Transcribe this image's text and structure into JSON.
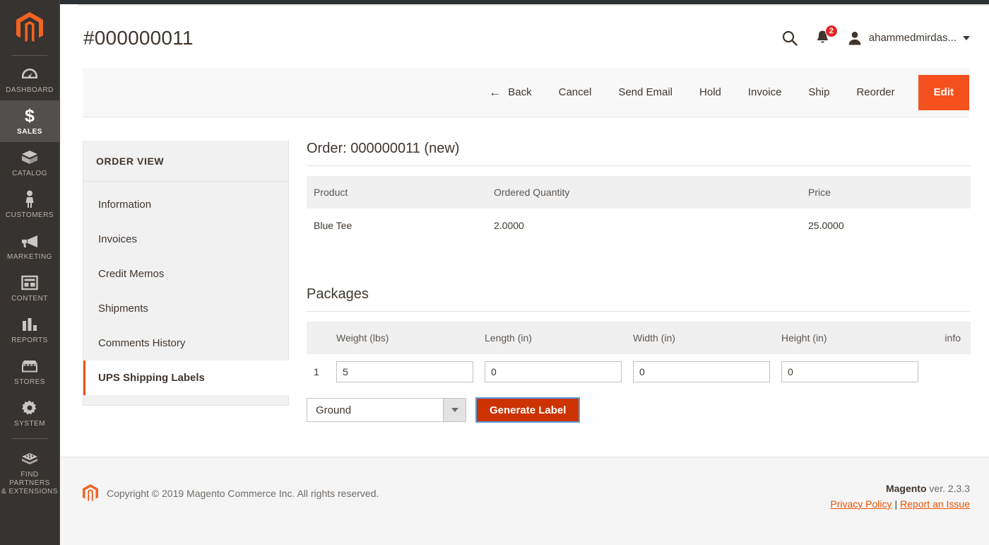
{
  "leftnav": {
    "logo_alt": "magento-logo",
    "items": [
      {
        "label": "DASHBOARD",
        "icon": "dashboard-icon",
        "active": false
      },
      {
        "label": "SALES",
        "icon": "dollar-icon",
        "active": true
      },
      {
        "label": "CATALOG",
        "icon": "box-icon",
        "active": false
      },
      {
        "label": "CUSTOMERS",
        "icon": "person-icon",
        "active": false
      },
      {
        "label": "MARKETING",
        "icon": "megaphone-icon",
        "active": false
      },
      {
        "label": "CONTENT",
        "icon": "layout-icon",
        "active": false
      },
      {
        "label": "REPORTS",
        "icon": "bar-chart-icon",
        "active": false
      },
      {
        "label": "STORES",
        "icon": "storefront-icon",
        "active": false
      },
      {
        "label": "SYSTEM",
        "icon": "gear-icon",
        "active": false
      },
      {
        "label": "FIND PARTNERS\n& EXTENSIONS",
        "icon": "blocks-icon",
        "active": false
      }
    ]
  },
  "header": {
    "title": "#000000011",
    "search_icon": "search-icon",
    "notifications_icon": "bell-icon",
    "notifications_count": "2",
    "user_icon": "user-avatar-icon",
    "user_name": "ahammedmirdas...",
    "user_caret": "chevron-down-icon"
  },
  "actions": {
    "back": "Back",
    "back_icon": "arrow-left-icon",
    "cancel": "Cancel",
    "send_email": "Send Email",
    "hold": "Hold",
    "invoice": "Invoice",
    "ship": "Ship",
    "reorder": "Reorder",
    "edit": "Edit"
  },
  "order_view": {
    "title": "ORDER VIEW",
    "items": [
      {
        "label": "Information",
        "active": false
      },
      {
        "label": "Invoices",
        "active": false
      },
      {
        "label": "Credit Memos",
        "active": false
      },
      {
        "label": "Shipments",
        "active": false
      },
      {
        "label": "Comments History",
        "active": false
      },
      {
        "label": "UPS Shipping Labels",
        "active": true
      }
    ]
  },
  "order_section": {
    "title": "Order: 000000011 (new)",
    "columns": [
      "Product",
      "Ordered Quantity",
      "Price"
    ],
    "rows": [
      {
        "product": "Blue Tee",
        "qty": "2.0000",
        "price": "25.0000"
      }
    ]
  },
  "packages_section": {
    "title": "Packages",
    "columns": [
      "",
      "Weight (lbs)",
      "Length (in)",
      "Width (in)",
      "Height (in)",
      "info"
    ],
    "rows": [
      {
        "index": "1",
        "weight": "5",
        "length": "0",
        "width": "0",
        "height": "0"
      }
    ],
    "shipping_method_value": "Ground",
    "shipping_method_caret": "chevron-down-icon",
    "generate_label_button": "Generate Label"
  },
  "footer": {
    "logo_alt": "magento-logo-small",
    "copyright": "Copyright © 2019 Magento Commerce Inc. All rights reserved.",
    "version_brand": "Magento",
    "version_text": " ver. 2.3.3",
    "privacy_policy": "Privacy Policy",
    "link_separator": "|",
    "report_issue": "Report an Issue"
  },
  "colors": {
    "accent_orange": "#eb5202",
    "primary_button": "#f4511e",
    "generate_button": "#cc3300",
    "badge_red": "#e22626",
    "nav_dark": "#373330"
  }
}
